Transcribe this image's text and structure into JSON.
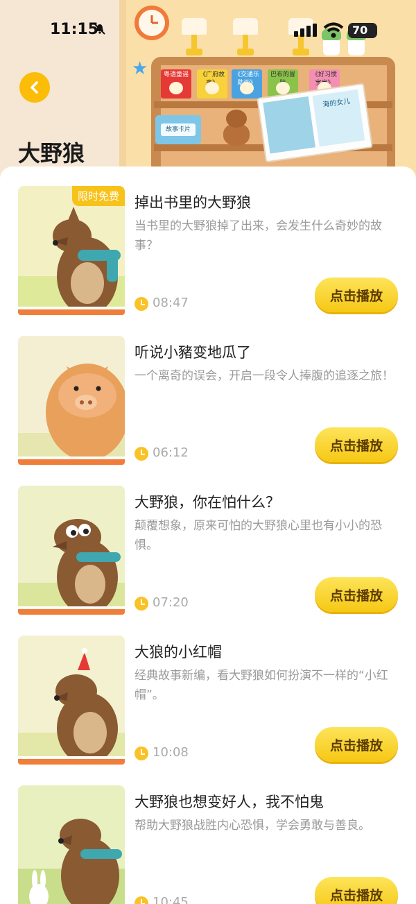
{
  "status_bar": {
    "time": "11:15",
    "battery": "70"
  },
  "header": {
    "title": "大野狼",
    "books": [
      "粤语童谣",
      "《广府故事》",
      "《交通乐助画》",
      "巴布的冒险",
      "《好习惯宝宝》"
    ],
    "storage_box_label": "故事卡片",
    "open_book_title": "海的女儿"
  },
  "stories": [
    {
      "title": "掉出书里的大野狼",
      "desc": "当书里的大野狼掉了出来，会发生什么奇妙的故事？",
      "duration": "08:47",
      "badge": "限时免费",
      "play_label": "点击播放",
      "cover": "wolf-scarf"
    },
    {
      "title": "听说小豬变地瓜了",
      "desc": "一个离奇的误会，开启一段令人捧腹的追逐之旅！",
      "duration": "06:12",
      "play_label": "点击播放",
      "cover": "pig"
    },
    {
      "title": "大野狼，你在怕什么？",
      "desc": "颠覆想象，原来可怕的大野狼心里也有小小的恐惧。",
      "duration": "07:20",
      "play_label": "点击播放",
      "cover": "wolf-scared"
    },
    {
      "title": "大狼的小红帽",
      "desc": "经典故事新编，看大野狼如何扮演不一样的“小红帽”。",
      "duration": "10:08",
      "play_label": "点击播放",
      "cover": "wolf-hat"
    },
    {
      "title": "大野狼也想变好人，我不怕鬼",
      "desc": "帮助大野狼战胜内心恐惧，学会勇敢与善良。",
      "duration": "10:45",
      "play_label": "点击播放",
      "cover": "wolf-rabbit"
    }
  ]
}
